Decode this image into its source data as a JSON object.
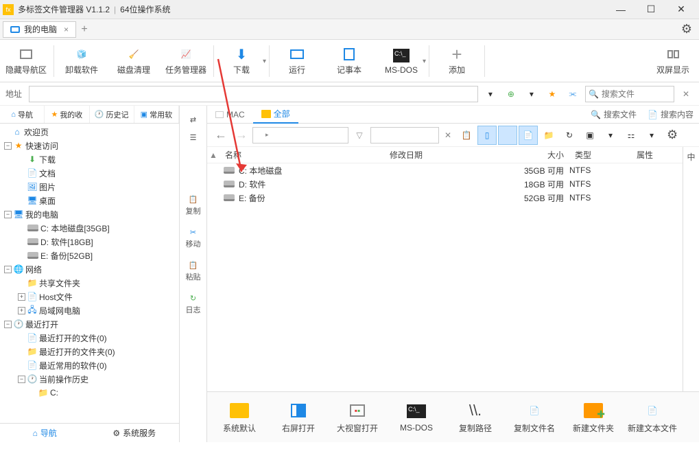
{
  "titlebar": {
    "app_name": "多标签文件管理器 V1.1.2",
    "os_info": "64位操作系统"
  },
  "tabs": {
    "main_tab": "我的电脑"
  },
  "toolbar": {
    "hide_nav": "隐藏导航区",
    "uninstall": "卸载软件",
    "disk_clean": "磁盘清理",
    "task_mgr": "任务管理器",
    "download": "下载",
    "run": "运行",
    "notepad": "记事本",
    "msdos": "MS-DOS",
    "add": "添加",
    "dual": "双屏显示"
  },
  "addrbar": {
    "label": "地址",
    "search_ph": "搜索文件"
  },
  "lefttabs": {
    "nav": "导航",
    "fav": "我的收",
    "hist": "历史记",
    "common": "常用软"
  },
  "tree": {
    "welcome": "欢迎页",
    "quick": "快速访问",
    "download": "下载",
    "docs": "文档",
    "pics": "图片",
    "desktop": "桌面",
    "mypc": "我的电脑",
    "c": "C: 本地磁盘[35GB]",
    "d": "D: 软件[18GB]",
    "e": "E: 备份[52GB]",
    "network": "网络",
    "share": "共享文件夹",
    "host": "Host文件",
    "lan": "局域网电脑",
    "recent": "最近打开",
    "recent_files": "最近打开的文件(0)",
    "recent_folders": "最近打开的文件夹(0)",
    "recent_soft": "最近常用的软件(0)",
    "history": "当前操作历史",
    "c_item": "C:"
  },
  "leftbottom": {
    "nav": "导航",
    "svc": "系统服务"
  },
  "sideactions": {
    "copy": "复制",
    "move": "移动",
    "paste": "粘贴",
    "log": "日志"
  },
  "content_tabs": {
    "mac": "MAC",
    "all": "全部",
    "search_file": "搜索文件",
    "search_content": "搜索内容"
  },
  "columns": {
    "name": "名称",
    "date": "修改日期",
    "size": "大小",
    "type": "类型",
    "attr": "属性"
  },
  "rows": [
    {
      "name": "C: 本地磁盘",
      "size": "35GB 可用",
      "type": "NTFS"
    },
    {
      "name": "D: 软件",
      "size": "18GB 可用",
      "type": "NTFS"
    },
    {
      "name": "E: 备份",
      "size": "52GB 可用",
      "type": "NTFS"
    }
  ],
  "sidecol": {
    "ch": "中"
  },
  "bottombar": {
    "default": "系统默认",
    "right_open": "右屏打开",
    "big_open": "大视窗打开",
    "msdos": "MS-DOS",
    "copy_path": "复制路径",
    "copy_name": "复制文件名",
    "new_folder": "新建文件夹",
    "new_text": "新建文本文件"
  }
}
